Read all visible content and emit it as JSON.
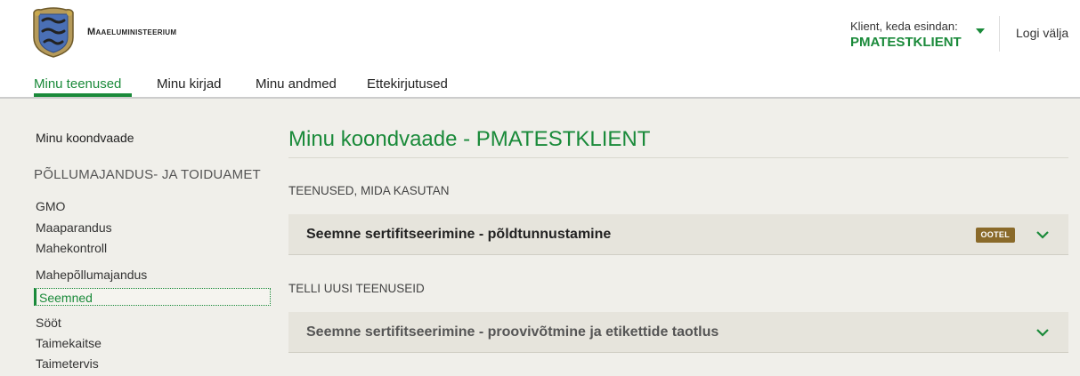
{
  "header": {
    "ministry_name": "Maaeluministeerium",
    "client_label": "Klient, keda esindan:",
    "client_name": "PMATESTKLIENT",
    "logout_label": "Logi välja"
  },
  "nav": {
    "tabs": [
      {
        "label": "Minu teenused",
        "active": true
      },
      {
        "label": "Minu kirjad",
        "active": false
      },
      {
        "label": "Minu andmed",
        "active": false
      },
      {
        "label": "Ettekirjutused",
        "active": false
      }
    ]
  },
  "sidebar": {
    "home_label": "Minu koondvaade",
    "section_heading": "PÕLLUMAJANDUS- JA TOIDUAMET",
    "items": [
      {
        "label": "GMO"
      },
      {
        "label": "Maaparandus"
      },
      {
        "label": "Mahekontroll"
      },
      {
        "label": "Mahepõllumajandus"
      },
      {
        "label": "Seemned",
        "active": true
      },
      {
        "label": "Sööt"
      },
      {
        "label": "Taimekaitse"
      },
      {
        "label": "Taimetervis"
      }
    ]
  },
  "main": {
    "title": "Minu koondvaade - PMATESTKLIENT",
    "used_services_label": "TEENUSED, MIDA KASUTAN",
    "used_services": [
      {
        "title": "Seemne sertifitseerimine - põldtunnustamine",
        "badge": "OOTEL"
      }
    ],
    "order_services_label": "TELLI UUSI TEENUSEID",
    "order_services": [
      {
        "title": "Seemne sertifitseerimine - proovivõtmine ja etikettide taotlus"
      }
    ]
  },
  "colors": {
    "accent": "#1a8a3a",
    "badge": "#8a6a2a",
    "content_bg": "#f0efea",
    "accordion_bg": "#e6e4dc"
  },
  "icons": [
    "coat-of-arms-logo",
    "caret-down-icon",
    "chevron-down-icon"
  ]
}
